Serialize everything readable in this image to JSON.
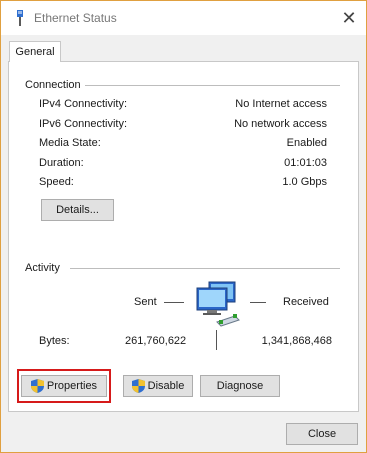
{
  "window": {
    "title": "Ethernet Status",
    "close_glyph": "✕"
  },
  "tabs": [
    {
      "label": "General"
    }
  ],
  "connection": {
    "section_label": "Connection",
    "rows": [
      {
        "label": "IPv4 Connectivity:",
        "value": "No Internet access"
      },
      {
        "label": "IPv6 Connectivity:",
        "value": "No network access"
      },
      {
        "label": "Media State:",
        "value": "Enabled"
      },
      {
        "label": "Duration:",
        "value": "01:01:03"
      },
      {
        "label": "Speed:",
        "value": "1.0 Gbps"
      }
    ],
    "details_button": "Details..."
  },
  "activity": {
    "section_label": "Activity",
    "sent_label": "Sent",
    "received_label": "Received",
    "bytes_label": "Bytes:",
    "bytes_sent": "261,760,622",
    "bytes_received": "1,341,868,468"
  },
  "buttons": {
    "properties": "Properties",
    "disable": "Disable",
    "diagnose": "Diagnose",
    "close": "Close"
  },
  "colors": {
    "highlight": "#d61a1a",
    "window_border": "#e0a040",
    "shield_blue": "#2f6fd0",
    "shield_yellow": "#f2c230"
  }
}
